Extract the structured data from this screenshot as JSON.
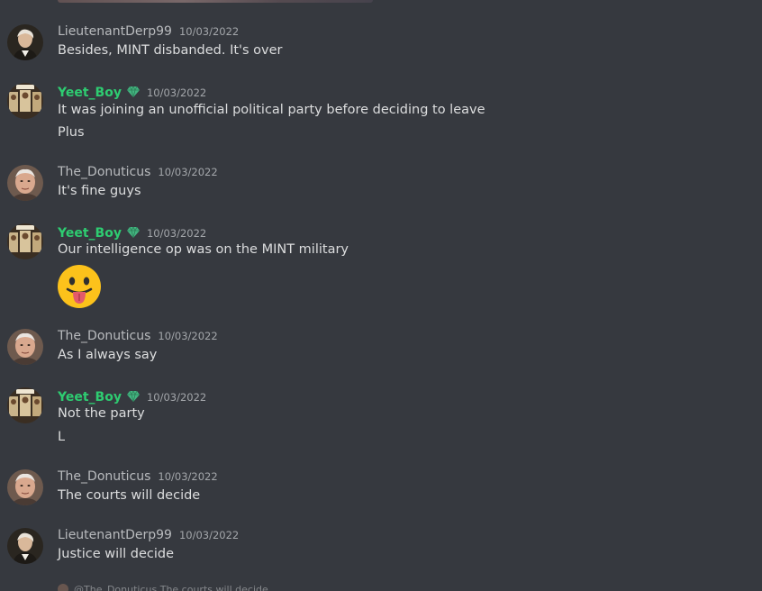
{
  "messages": [
    {
      "username": "LieutenantDerp99",
      "timestamp": "10/03/2022",
      "avatar": "portrait-avatar",
      "lines": [
        "Besides, MINT disbanded. It's over"
      ]
    },
    {
      "username": "Yeet_Boy",
      "timestamp": "10/03/2022",
      "avatar": "group-photo-avatar",
      "badge": "nitro-gem-icon",
      "lines": [
        "It was joining an unofficial political party before deciding to leave",
        "Plus"
      ]
    },
    {
      "username": "The_Donuticus",
      "timestamp": "10/03/2022",
      "avatar": "man-photo-avatar",
      "lines": [
        "It's fine guys"
      ]
    },
    {
      "username": "Yeet_Boy",
      "timestamp": "10/03/2022",
      "avatar": "group-photo-avatar",
      "badge": "nitro-gem-icon",
      "lines": [
        "Our intelligence op was on the MINT military"
      ],
      "emoji": "tongue-out-emoji"
    },
    {
      "username": "The_Donuticus",
      "timestamp": "10/03/2022",
      "avatar": "man-photo-avatar",
      "lines": [
        "As I always say"
      ]
    },
    {
      "username": "Yeet_Boy",
      "timestamp": "10/03/2022",
      "avatar": "group-photo-avatar",
      "badge": "nitro-gem-icon",
      "lines": [
        "Not the party",
        "L"
      ]
    },
    {
      "username": "The_Donuticus",
      "timestamp": "10/03/2022",
      "avatar": "man-photo-avatar",
      "lines": [
        "The courts will decide"
      ]
    },
    {
      "username": "LieutenantDerp99",
      "timestamp": "10/03/2022",
      "avatar": "portrait-avatar",
      "lines": [
        "Justice will decide"
      ]
    }
  ],
  "bottom_peek": {
    "text": "@The_Donuticus The courts will decide"
  },
  "colors": {
    "background": "#36393f",
    "username_default": "#b9bbbe",
    "username_green": "#2ecc71",
    "message_text": "#dcddde",
    "timestamp": "#a3a6aa",
    "nitro_gem": "#43b581"
  }
}
